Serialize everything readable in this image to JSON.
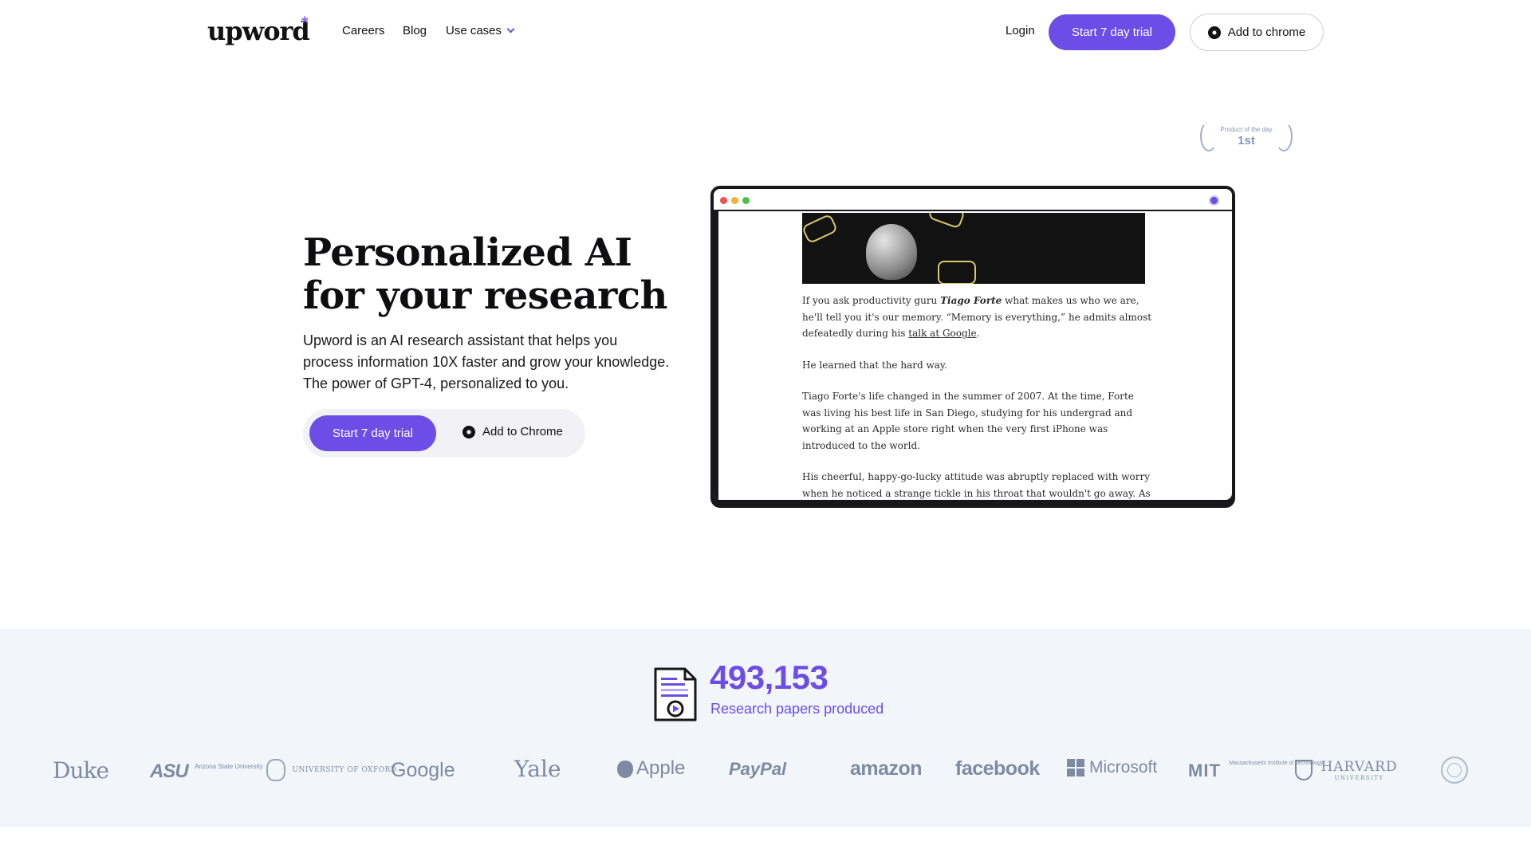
{
  "nav": {
    "logo": "upword",
    "logo_mark": "*",
    "links": [
      "Careers",
      "Blog",
      "Use cases"
    ],
    "login": "Login",
    "trial_cta": "Start 7 day trial",
    "chrome_cta": "Add to chrome"
  },
  "badge": {
    "label": "Product of the day",
    "rank": "1st"
  },
  "hero": {
    "title_line1": "Personalized AI",
    "title_line2": "for your research",
    "subtitle": "Upword is an AI research assistant that helps you process information 10X faster and grow your knowledge. The power of GPT-4, personalized to you.",
    "trial_cta": "Start 7 day trial",
    "chrome_cta": "Add to Chrome"
  },
  "article": {
    "p1_a": "If you ask productivity guru ",
    "p1_name": "Tiago Forte",
    "p1_b": " what makes us who we are, he'll tell you it's our memory. “Memory is everything,” he admits almost defeatedly during his ",
    "p1_link": "talk at Google",
    "p1_c": ".",
    "p2": "He learned that the hard way.",
    "p3": "Tiago Forte's life changed in the summer of 2007. At the time, Forte was living his best life in San Diego, studying for his undergrad and working at an Apple store right when the very first iPhone was introduced to the world.",
    "p4": "His cheerful, happy-go-lucky attitude was abruptly replaced with worry when he noticed a strange tickle in his throat that wouldn't go away. As time"
  },
  "stats": {
    "count": "493,153",
    "label": "Research papers produced"
  },
  "logos": [
    "Duke",
    "ASU",
    "Arizona State University",
    "UNIVERSITY OF OXFORD",
    "Google",
    "Yale",
    "Apple",
    "PayPal",
    "amazon",
    "facebook",
    "Microsoft",
    "MIT",
    "Massachusetts Institute of Technology",
    "HARVARD",
    "UNIVERSITY"
  ],
  "colors": {
    "brand": "#6c4ee6",
    "band_bg": "#f2f6fb",
    "logo_gray": "#7d8aa2"
  }
}
